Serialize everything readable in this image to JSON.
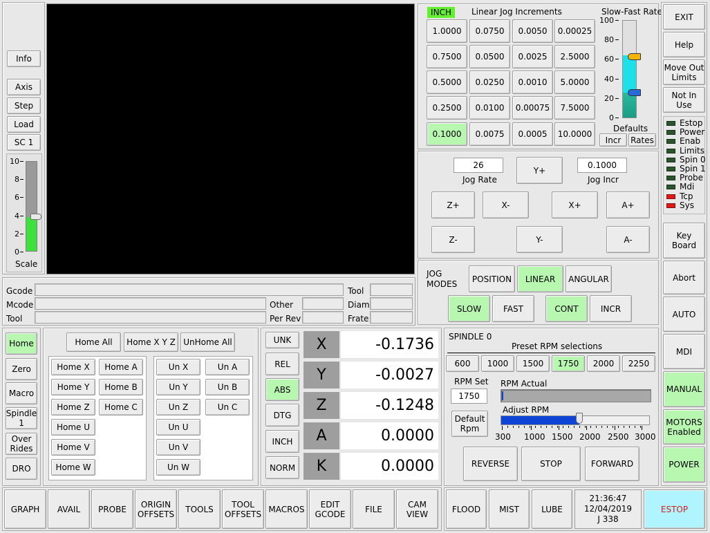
{
  "left_bar": {
    "info": "Info",
    "axis": "Axis",
    "step": "Step",
    "load": "Load",
    "sc1": "SC 1",
    "scale_ticks": [
      "10",
      "8",
      "6",
      "4",
      "2",
      "0"
    ],
    "scale_label": "Scale",
    "scale_level": 0.38
  },
  "jog": {
    "unit_badge": "INCH",
    "title": "Linear Jog Increments",
    "increments": [
      [
        "1.0000",
        "0.0750",
        "0.0050",
        "0.00025"
      ],
      [
        "0.7500",
        "0.0500",
        "0.0025",
        "2.5000"
      ],
      [
        "0.5000",
        "0.0250",
        "0.0010",
        "5.0000"
      ],
      [
        "0.2500",
        "0.0100",
        "0.00075",
        "7.5000"
      ],
      [
        "0.1000",
        "0.0075",
        "0.0005",
        "10.0000"
      ]
    ],
    "rate_title": "Slow-Fast Rate",
    "rate_ticks": [
      "100",
      "80",
      "60",
      "40",
      "20",
      "0"
    ],
    "rate_fill": 0.64,
    "rate_marker_upper": 0.63,
    "rate_marker_lower": 0.26,
    "defaults_label": "Defaults",
    "incr_btn": "Incr",
    "rates_btn": "Rates",
    "jog_rate_value": "26",
    "jog_rate_label": "Jog Rate",
    "jog_incr_value": "0.1000",
    "jog_incr_label": "Jog Incr",
    "y_plus": "Y+",
    "z_plus": "Z+",
    "x_minus": "X-",
    "x_plus": "X+",
    "a_plus": "A+",
    "z_minus": "Z-",
    "y_minus": "Y-",
    "a_minus": "A-",
    "modes_label": "JOG\nMODES",
    "position": "POSITION",
    "linear": "LINEAR",
    "angular": "ANGULAR",
    "slow": "SLOW",
    "fast": "FAST",
    "cont": "CONT",
    "incr": "INCR"
  },
  "right_bar": {
    "exit": "EXIT",
    "help": "Help",
    "move_out": "Move Out\nLimits",
    "not_in_use": "Not In\nUse",
    "leds": [
      {
        "label": "Estop",
        "color": "#2b552b"
      },
      {
        "label": "Power",
        "color": "#2b552b"
      },
      {
        "label": "Enab",
        "color": "#2b552b"
      },
      {
        "label": "Limits",
        "color": "#2b552b"
      },
      {
        "label": "Spin 0",
        "color": "#2b552b"
      },
      {
        "label": "Spin 1",
        "color": "#2b552b"
      },
      {
        "label": "Probe",
        "color": "#2b552b"
      },
      {
        "label": "Mdi",
        "color": "#2b552b"
      },
      {
        "label": "Tcp",
        "color": "#e01818"
      },
      {
        "label": "Sys",
        "color": "#e01818"
      }
    ],
    "keyboard": "Key Board",
    "abort": "Abort",
    "auto": "AUTO",
    "mdi": "MDI",
    "manual": "MANUAL",
    "motors": "MOTORS\nEnabled",
    "power": "POWER"
  },
  "status": {
    "gcode": "Gcode",
    "mcode": "Mcode",
    "tool": "Tool",
    "tool2": "Tool",
    "other": "Other",
    "diam": "Diam",
    "per_rev": "Per Rev",
    "frate": "Frate"
  },
  "left_modes": {
    "home": "Home",
    "zero": "Zero",
    "macro": "Macro",
    "spindle": "Spindle\n1",
    "overrides": "Over\nRides",
    "dro": "DRO"
  },
  "homing": {
    "home_all": "Home All",
    "home_xyz": "Home  X Y Z",
    "unhome_all": "UnHome All",
    "home": [
      "Home  X",
      "Home  Y",
      "Home  Z",
      "Home  U",
      "Home  V",
      "Home  W"
    ],
    "home_b": [
      "Home  A",
      "Home  B",
      "Home  C"
    ],
    "unhome": [
      "Un  X",
      "Un  Y",
      "Un  Z",
      "Un  U",
      "Un  V",
      "Un  W"
    ],
    "unhome_b": [
      "Un  A",
      "Un  B",
      "Un  C"
    ]
  },
  "dro": {
    "modes": [
      "UNK",
      "REL",
      "ABS",
      "DTG",
      "INCH",
      "NORM"
    ],
    "axes": [
      {
        "name": "X",
        "value": "-0.1736"
      },
      {
        "name": "Y",
        "value": "-0.0027"
      },
      {
        "name": "Z",
        "value": "-0.1248"
      },
      {
        "name": "A",
        "value": "0.0000"
      },
      {
        "name": "K",
        "value": "0.0000"
      }
    ]
  },
  "spindle": {
    "title": "SPINDLE  0",
    "preset_title": "Preset RPM selections",
    "presets": [
      "600",
      "1000",
      "1500",
      "1750",
      "2000",
      "2250"
    ],
    "rpm_set_label": "RPM Set",
    "rpm_set_value": "1750",
    "rpm_actual_label": "RPM Actual",
    "default_rpm": "Default\nRpm",
    "adjust_label": "Adjust RPM",
    "adjust_ticks": [
      "300",
      "1000",
      "1500",
      "2000",
      "2500",
      "3000"
    ],
    "adjust_fraction": 0.53,
    "reverse": "REVERSE",
    "stop": "STOP",
    "forward": "FORWARD"
  },
  "bottom_bar": {
    "tabs": [
      "GRAPH",
      "AVAIL",
      "PROBE",
      "ORIGIN\nOFFSETS",
      "TOOLS",
      "TOOL\nOFFSETS",
      "MACROS",
      "EDIT\nGCODE",
      "FILE",
      "CAM\nVIEW"
    ],
    "flood": "FLOOD",
    "mist": "MIST",
    "lube": "LUBE",
    "time": "21:36:47",
    "date": "12/04/2019",
    "job": "J 338",
    "estop": "ESTOP"
  },
  "colors": {
    "active_green": "#b8f7b0",
    "slider_green": "#3ee03e",
    "spindle_blue": "#0f45d6",
    "rate_cyan": "#1ee0e8",
    "estop_bg": "#b0f4ff",
    "estop_text": "#d22020"
  }
}
